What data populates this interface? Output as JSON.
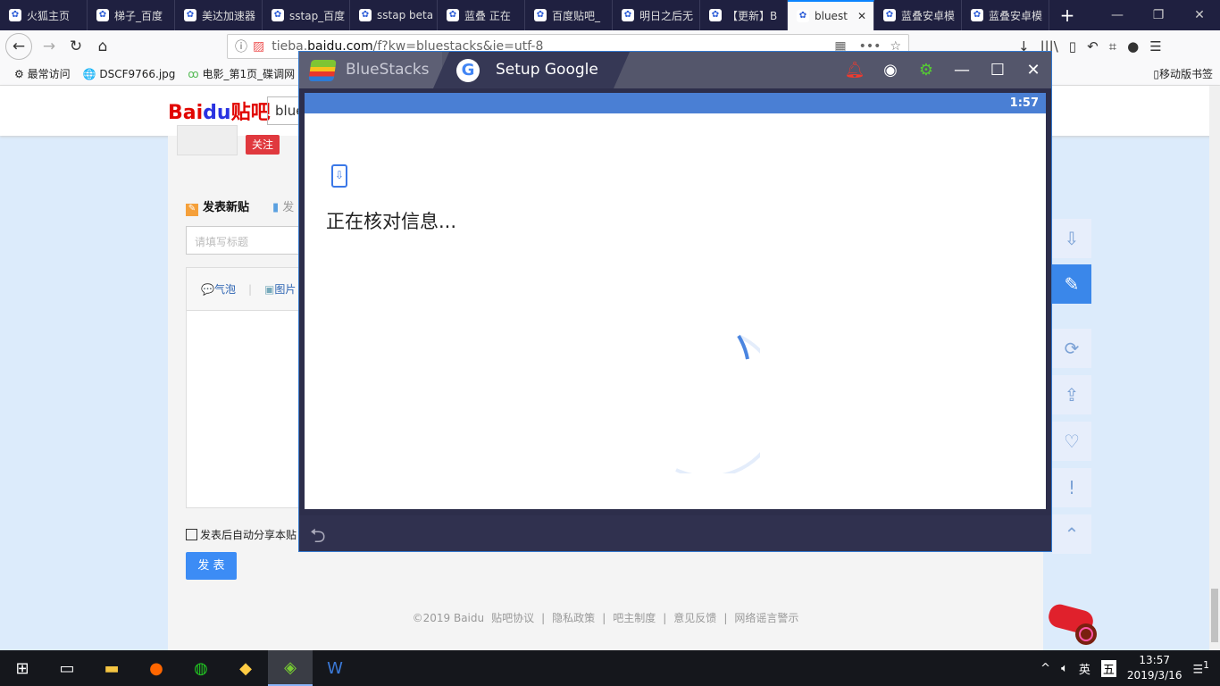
{
  "browser": {
    "tabs": [
      {
        "label": "火狐主页",
        "icon": "firefox-icon"
      },
      {
        "label": "梯子_百度",
        "icon": "baidu-paw-icon"
      },
      {
        "label": "美达加速器",
        "icon": "s-icon"
      },
      {
        "label": "sstap_百度",
        "icon": "baidu-paw-icon"
      },
      {
        "label": "sstap beta",
        "icon": "baidu-paw-icon"
      },
      {
        "label": "蓝叠 正在",
        "icon": "baidu-paw-icon"
      },
      {
        "label": "百度贴吧_",
        "icon": "baidu-paw-icon"
      },
      {
        "label": "明日之后无",
        "icon": "baidu-paw-icon"
      },
      {
        "label": "【更新】B",
        "icon": "baidu-paw-icon"
      },
      {
        "label": "bluest",
        "icon": "baidu-paw-icon",
        "active": true
      },
      {
        "label": "蓝叠安卓模",
        "icon": "green-logo-icon"
      },
      {
        "label": "蓝叠安卓模",
        "icon": "seven-logo-icon"
      }
    ],
    "url_prefix": "tieba.",
    "url_domain": "baidu.com",
    "url_path": "/f?kw=bluestacks&ie=utf-8",
    "bookmarks": [
      "最常访问",
      "DSCF9766.jpg",
      "电影_第1页_碟调网"
    ],
    "mobile_bookmarks": "移动版书签"
  },
  "tieba": {
    "logo": "Bai",
    "logo_du": "du",
    "logo_suffix": "贴吧",
    "search_value": "blue",
    "follow": "关注",
    "new_post": "发表新贴",
    "vote": "发",
    "title_placeholder": "请填写标题",
    "bubble": "气泡",
    "image": "图片",
    "auto_share": "发表后自动分享本贴",
    "post_button": "发 表",
    "footer": [
      "©2019 Baidu",
      "贴吧协议",
      "|",
      "隐私政策",
      "|",
      "吧主制度",
      "|",
      "意见反馈",
      "|",
      "网络谣言警示"
    ]
  },
  "bluestacks": {
    "app_name": "BlueStacks",
    "tab_title": "Setup Google",
    "time": "1:57",
    "message": "正在核对信息..."
  },
  "taskbar": {
    "lang": "英",
    "ime": "五",
    "time": "13:57",
    "date": "2019/3/16",
    "notifications": "1"
  }
}
